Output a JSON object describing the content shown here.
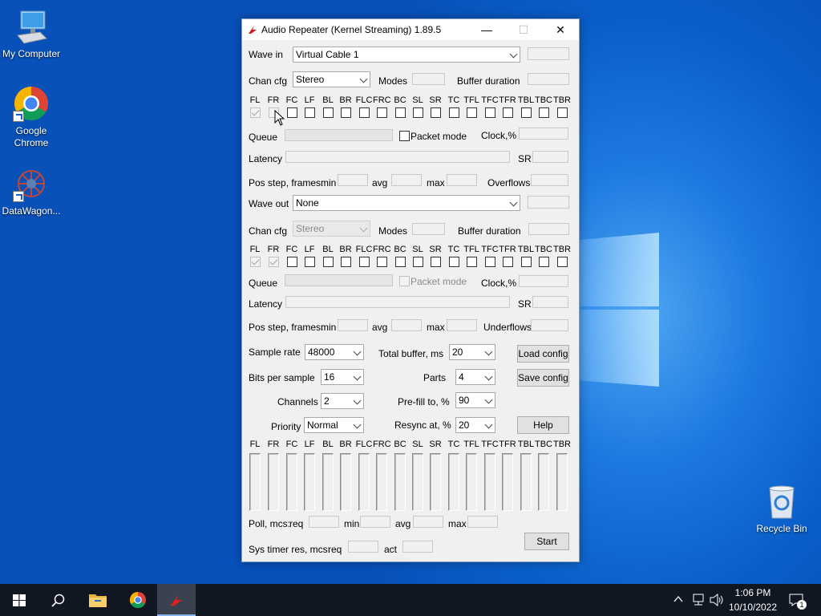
{
  "desktop": {
    "icons": [
      {
        "label": "My Computer",
        "icon": "computer-icon"
      },
      {
        "label": "Google Chrome",
        "line1": "Google",
        "line2": "Chrome",
        "icon": "chrome-icon"
      },
      {
        "label": "DataWagon...",
        "icon": "datawagon-icon"
      },
      {
        "label": "Recycle Bin",
        "icon": "recycle-bin-icon"
      }
    ]
  },
  "window": {
    "title": "Audio Repeater (Kernel Streaming) 1.89.5",
    "minimize": "—",
    "maximize": "☐",
    "close": "✕",
    "wave_in": {
      "label": "Wave in",
      "device": "Virtual Cable 1",
      "value": ""
    },
    "in_chan": {
      "label": "Chan cfg",
      "value": "Stereo",
      "modes_label": "Modes",
      "buffer_label": "Buffer duration"
    },
    "channels": [
      "FL",
      "FR",
      "FC",
      "LF",
      "BL",
      "BR",
      "FLC",
      "FRC",
      "BC",
      "SL",
      "SR",
      "TC",
      "TFL",
      "TFC",
      "TFR",
      "TBL",
      "TBC",
      "TBR"
    ],
    "in_queue": {
      "label": "Queue",
      "packet_mode": "Packet mode",
      "clock_label": "Clock,%"
    },
    "in_latency": {
      "label": "Latency",
      "sr_label": "SR"
    },
    "in_pos": {
      "label": "Pos step, frames:",
      "min": "min",
      "avg": "avg",
      "max": "max",
      "flow_label": "Overflows"
    },
    "wave_out": {
      "label": "Wave out",
      "device": "None"
    },
    "out_chan": {
      "label": "Chan cfg",
      "value": "Stereo",
      "modes_label": "Modes",
      "buffer_label": "Buffer duration"
    },
    "out_queue": {
      "label": "Queue",
      "packet_mode": "Packet mode",
      "clock_label": "Clock,%"
    },
    "out_latency": {
      "label": "Latency",
      "sr_label": "SR"
    },
    "out_pos": {
      "label": "Pos step, frames:",
      "min": "min",
      "avg": "avg",
      "max": "max",
      "flow_label": "Underflows"
    },
    "settings": {
      "sample_rate_label": "Sample rate",
      "sample_rate": "48000",
      "total_buffer_label": "Total buffer, ms",
      "total_buffer": "20",
      "bits_label": "Bits per sample",
      "bits": "16",
      "parts_label": "Parts",
      "parts": "4",
      "channels_label": "Channels",
      "channels": "2",
      "prefill_label": "Pre-fill to, %",
      "prefill": "90",
      "priority_label": "Priority",
      "priority": "Normal",
      "resync_label": "Resync at, %",
      "resync": "20"
    },
    "buttons": {
      "load": "Load config",
      "save": "Save config",
      "help": "Help",
      "start": "Start"
    },
    "poll": {
      "label": "Poll, mcs:",
      "req": "req",
      "min": "min",
      "avg": "avg",
      "max": "max"
    },
    "timer": {
      "label": "Sys timer res, mcs:",
      "req": "req",
      "act": "act"
    }
  },
  "taskbar": {
    "time": "1:06 PM",
    "date": "10/10/2022",
    "notifications": "1",
    "items": [
      "start-icon",
      "search-icon",
      "file-explorer-icon",
      "chrome-icon",
      "audio-repeater-icon"
    ]
  }
}
